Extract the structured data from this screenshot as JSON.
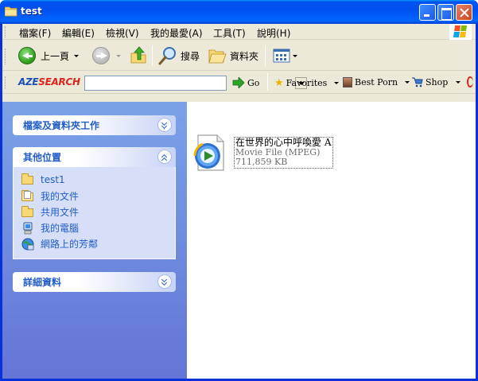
{
  "window": {
    "title": "test"
  },
  "menu": {
    "items": [
      "檔案(F)",
      "編輯(E)",
      "檢視(V)",
      "我的最愛(A)",
      "工具(T)",
      "說明(H)"
    ]
  },
  "toolbar": {
    "back_label": "上一頁",
    "search_label": "搜尋",
    "folders_label": "資料夾"
  },
  "aze": {
    "logo_blue": "AZE",
    "logo_red": "SEARCH",
    "search_value": "",
    "go_label": "Go",
    "favorites_label": "Favorites",
    "bestporn_label": "Best Porn",
    "shop_label": "Shop"
  },
  "task_pane": {
    "file_tasks_title": "檔案及資料夾工作",
    "other_places_title": "其他位置",
    "details_title": "詳細資料",
    "places": [
      {
        "label": "test1",
        "icon": "folder-icon"
      },
      {
        "label": "我的文件",
        "icon": "my-documents-icon"
      },
      {
        "label": "共用文件",
        "icon": "shared-documents-icon"
      },
      {
        "label": "我的電腦",
        "icon": "my-computer-icon"
      },
      {
        "label": "網路上的芳鄰",
        "icon": "network-places-icon"
      }
    ]
  },
  "files": [
    {
      "name": "在世界的心中呼喚愛 A",
      "type": "Movie File (MPEG)",
      "size": "711,859 KB",
      "icon": "windows-media-player-icon"
    }
  ],
  "colors": {
    "title_bar": "#0053ee",
    "task_pane_top": "#7ba2e7",
    "task_pane_bottom": "#6375d6",
    "link_blue": "#215dc6",
    "panel_body": "#d6dff7"
  }
}
